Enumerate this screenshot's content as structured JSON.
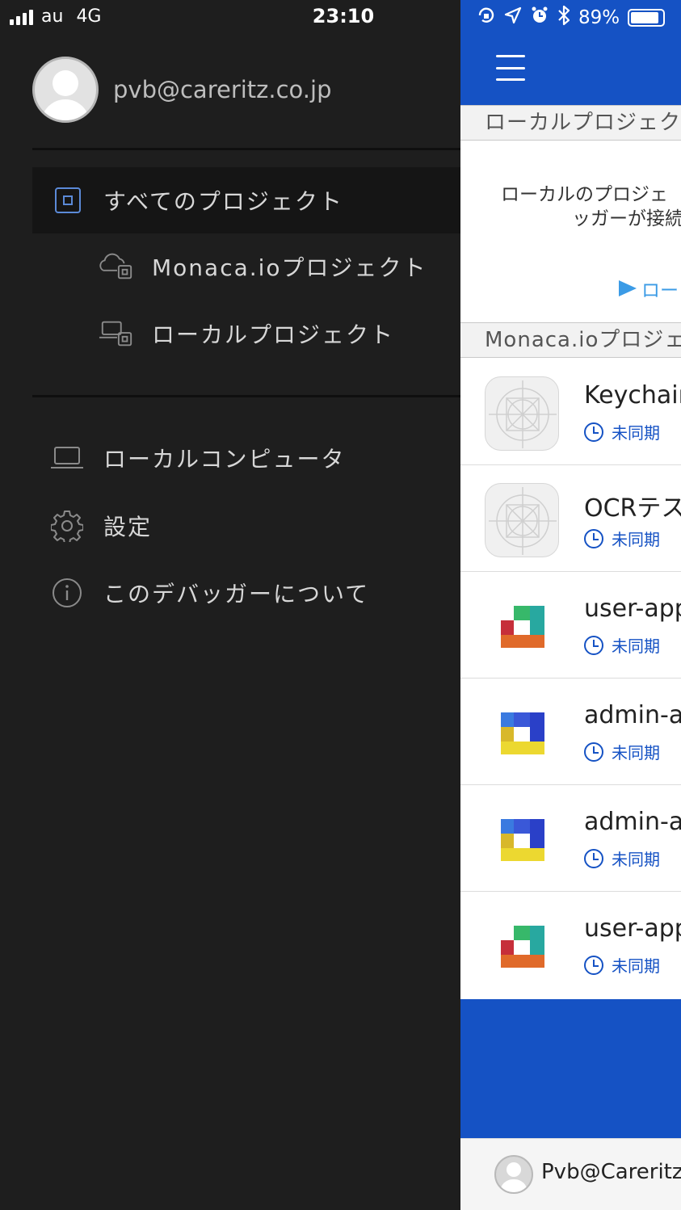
{
  "status_bar": {
    "carrier": "au",
    "network": "4G",
    "time": "23:10",
    "battery": "89%",
    "icons": [
      "signal-icon",
      "rotation-lock-icon",
      "location-icon",
      "alarm-icon",
      "bluetooth-icon",
      "battery-icon"
    ]
  },
  "drawer": {
    "profile_email": "pvb@careritz.co.jp",
    "nav": [
      {
        "label": "すべてのプロジェクト",
        "icon": "project-box-icon",
        "active": true
      },
      {
        "label": "Monaca.ioプロジェクト",
        "icon": "cloud-project-icon"
      },
      {
        "label": "ローカルプロジェクト",
        "icon": "local-project-icon"
      }
    ],
    "bottom_nav": [
      {
        "label": "ローカルコンピュータ",
        "icon": "laptop-icon"
      },
      {
        "label": "設定",
        "icon": "gear-icon"
      },
      {
        "label": "このデバッガーについて",
        "icon": "info-icon"
      }
    ]
  },
  "main": {
    "local_section_title": "ローカルプロジェク",
    "local_message_line1": "ローカルのプロジェ",
    "local_message_line2": "ッガーが接続",
    "local_link": "ロー",
    "monaca_section_title": "Monaca.ioプロジェ",
    "projects": [
      {
        "name": "Keychain",
        "sync": "未同期",
        "icon": "placeholder-app-icon"
      },
      {
        "name": "OCRテス",
        "sync": "未同期",
        "icon": "placeholder-app-icon"
      },
      {
        "name": "user-app",
        "sync": "未同期",
        "icon": "monaca-red-green-icon"
      },
      {
        "name": "admin-a",
        "sync": "未同期",
        "icon": "monaca-blue-yellow-icon"
      },
      {
        "name": "admin-a",
        "sync": "未同期",
        "icon": "monaca-blue-yellow-icon"
      },
      {
        "name": "user-app",
        "sync": "未同期",
        "icon": "monaca-red-green-icon"
      }
    ],
    "footer_user": "Pvb@Careritz."
  },
  "colors": {
    "drawer_bg": "#1e1e1e",
    "header_blue": "#1552c4",
    "link_blue": "#3b9be6",
    "active_icon": "#5b8ad8"
  }
}
